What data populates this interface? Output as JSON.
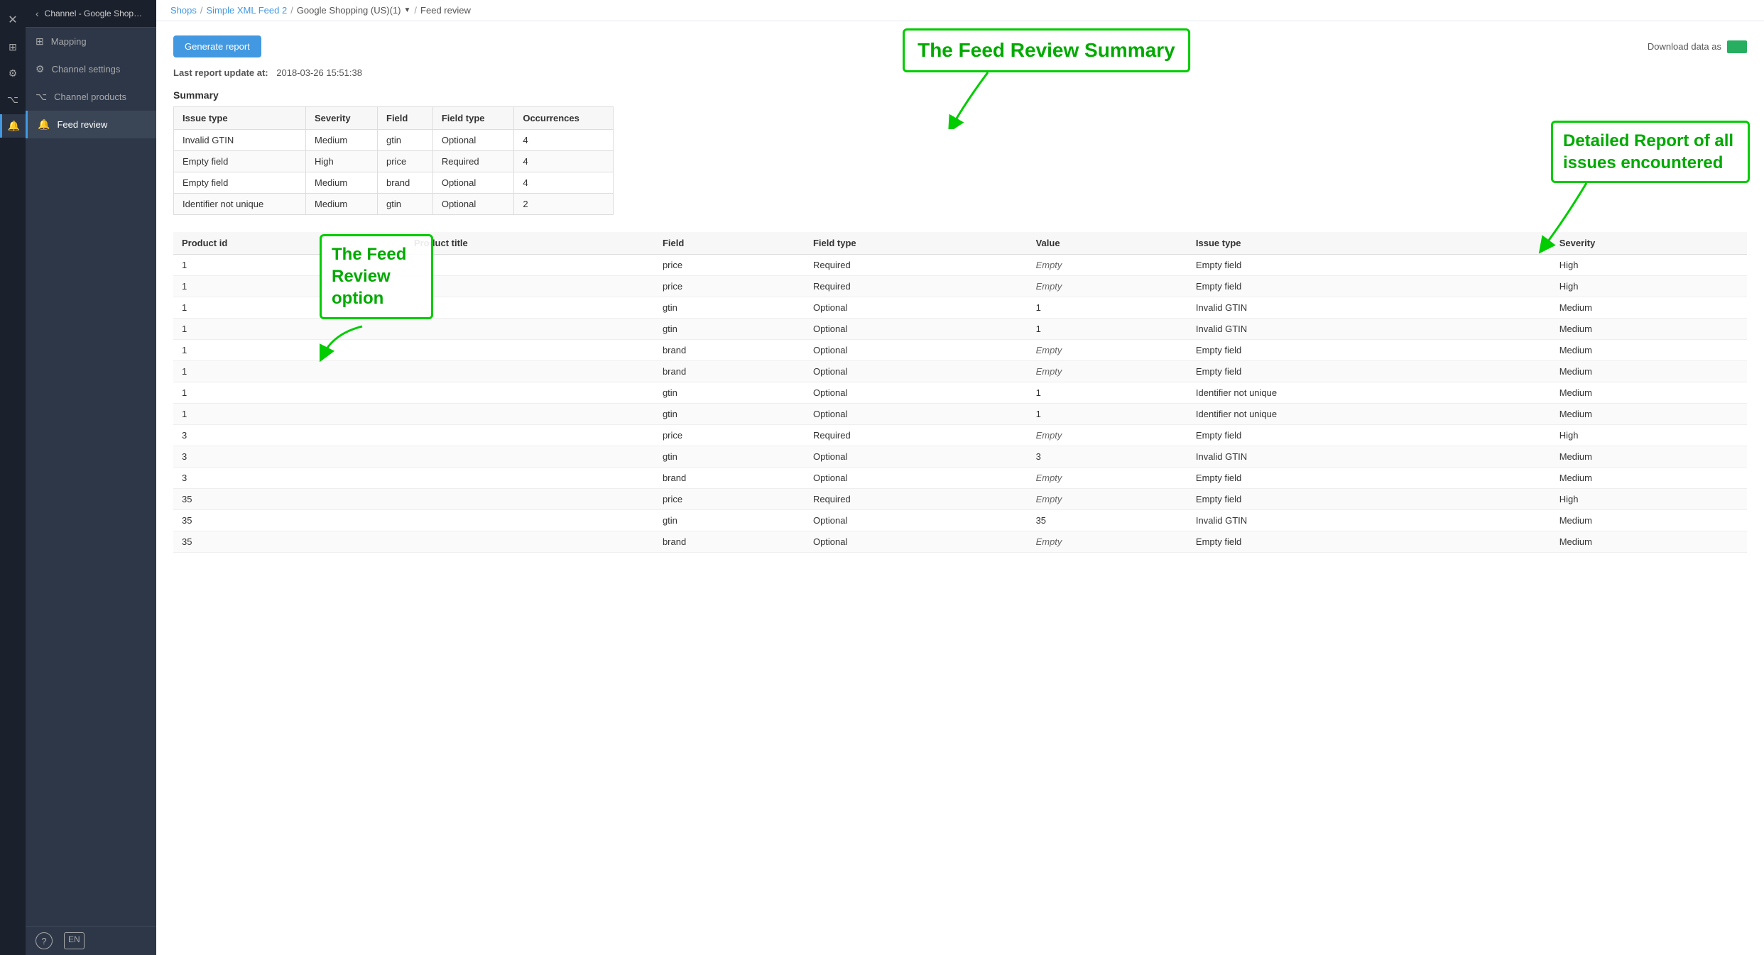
{
  "sidebar": {
    "channel_name": "Channel - Google Shopping...",
    "items": [
      {
        "label": "Mapping",
        "icon": "⊞",
        "active": false
      },
      {
        "label": "Channel settings",
        "icon": "⚙",
        "active": false
      },
      {
        "label": "Channel products",
        "icon": "📦",
        "active": false
      },
      {
        "label": "Feed review",
        "icon": "🔔",
        "active": true
      }
    ],
    "bottom_items": [
      {
        "label": "?",
        "icon": "?"
      },
      {
        "label": "EN",
        "icon": "EN"
      }
    ]
  },
  "topbar": {
    "breadcrumbs": [
      {
        "label": "Shops",
        "link": true
      },
      {
        "label": "Simple XML Feed 2",
        "link": true
      },
      {
        "label": "Google Shopping (US)(1)",
        "dropdown": true
      },
      {
        "label": "Feed review",
        "link": false
      }
    ]
  },
  "toolbar": {
    "generate_label": "Generate report",
    "download_label": "Download data as"
  },
  "last_update": {
    "label": "Last report update at:",
    "value": "2018-03-26 15:51:38"
  },
  "summary": {
    "title": "Summary",
    "headers": [
      "Issue type",
      "Severity",
      "Field",
      "Field type",
      "Occurrences"
    ],
    "rows": [
      {
        "issue_type": "Invalid GTIN",
        "severity": "Medium",
        "field": "gtin",
        "field_type": "Optional",
        "occurrences": "4"
      },
      {
        "issue_type": "Empty field",
        "severity": "High",
        "field": "price",
        "field_type": "Required",
        "occurrences": "4"
      },
      {
        "issue_type": "Empty field",
        "severity": "Medium",
        "field": "brand",
        "field_type": "Optional",
        "occurrences": "4"
      },
      {
        "issue_type": "Identifier not unique",
        "severity": "Medium",
        "field": "gtin",
        "field_type": "Optional",
        "occurrences": "2"
      }
    ]
  },
  "detail": {
    "headers": [
      "Product id",
      "Product title",
      "Field",
      "Field type",
      "Value",
      "Issue type",
      "Severity"
    ],
    "rows": [
      {
        "product_id": "1",
        "product_title": "",
        "field": "price",
        "field_type": "Required",
        "value": "Empty",
        "value_italic": true,
        "issue_type": "Empty field",
        "severity": "High"
      },
      {
        "product_id": "1",
        "product_title": "",
        "field": "price",
        "field_type": "Required",
        "value": "Empty",
        "value_italic": true,
        "issue_type": "Empty field",
        "severity": "High"
      },
      {
        "product_id": "1",
        "product_title": "",
        "field": "gtin",
        "field_type": "Optional",
        "value": "1",
        "value_italic": false,
        "issue_type": "Invalid GTIN",
        "severity": "Medium"
      },
      {
        "product_id": "1",
        "product_title": "",
        "field": "gtin",
        "field_type": "Optional",
        "value": "1",
        "value_italic": false,
        "issue_type": "Invalid GTIN",
        "severity": "Medium"
      },
      {
        "product_id": "1",
        "product_title": "",
        "field": "brand",
        "field_type": "Optional",
        "value": "Empty",
        "value_italic": true,
        "issue_type": "Empty field",
        "severity": "Medium"
      },
      {
        "product_id": "1",
        "product_title": "",
        "field": "brand",
        "field_type": "Optional",
        "value": "Empty",
        "value_italic": true,
        "issue_type": "Empty field",
        "severity": "Medium"
      },
      {
        "product_id": "1",
        "product_title": "",
        "field": "gtin",
        "field_type": "Optional",
        "value": "1",
        "value_italic": false,
        "issue_type": "Identifier not unique",
        "severity": "Medium"
      },
      {
        "product_id": "1",
        "product_title": "",
        "field": "gtin",
        "field_type": "Optional",
        "value": "1",
        "value_italic": false,
        "issue_type": "Identifier not unique",
        "severity": "Medium"
      },
      {
        "product_id": "3",
        "product_title": "",
        "field": "price",
        "field_type": "Required",
        "value": "Empty",
        "value_italic": true,
        "issue_type": "Empty field",
        "severity": "High"
      },
      {
        "product_id": "3",
        "product_title": "",
        "field": "gtin",
        "field_type": "Optional",
        "value": "3",
        "value_italic": false,
        "issue_type": "Invalid GTIN",
        "severity": "Medium"
      },
      {
        "product_id": "3",
        "product_title": "",
        "field": "brand",
        "field_type": "Optional",
        "value": "Empty",
        "value_italic": true,
        "issue_type": "Empty field",
        "severity": "Medium"
      },
      {
        "product_id": "35",
        "product_title": "",
        "field": "price",
        "field_type": "Required",
        "value": "Empty",
        "value_italic": true,
        "issue_type": "Empty field",
        "severity": "High"
      },
      {
        "product_id": "35",
        "product_title": "",
        "field": "gtin",
        "field_type": "Optional",
        "value": "35",
        "value_italic": false,
        "issue_type": "Invalid GTIN",
        "severity": "Medium"
      },
      {
        "product_id": "35",
        "product_title": "",
        "field": "brand",
        "field_type": "Optional",
        "value": "Empty",
        "value_italic": true,
        "issue_type": "Empty field",
        "severity": "Medium"
      }
    ]
  },
  "annotations": {
    "summary_title": "The Feed Review Summary",
    "feed_review_option": "The Feed Review option",
    "detailed_report": "Detailed Report of all issues encountered"
  }
}
